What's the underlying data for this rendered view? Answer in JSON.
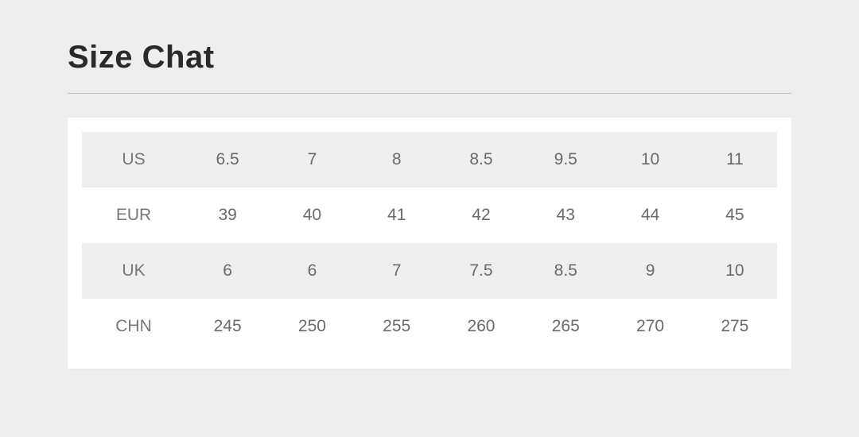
{
  "title": "Size Chat",
  "chart_data": {
    "type": "table",
    "rows": [
      {
        "label": "US",
        "values": [
          "6.5",
          "7",
          "8",
          "8.5",
          "9.5",
          "10",
          "11"
        ]
      },
      {
        "label": "EUR",
        "values": [
          "39",
          "40",
          "41",
          "42",
          "43",
          "44",
          "45"
        ]
      },
      {
        "label": "UK",
        "values": [
          "6",
          "6",
          "7",
          "7.5",
          "8.5",
          "9",
          "10"
        ]
      },
      {
        "label": "CHN",
        "values": [
          "245",
          "250",
          "255",
          "260",
          "265",
          "270",
          "275"
        ]
      }
    ]
  }
}
